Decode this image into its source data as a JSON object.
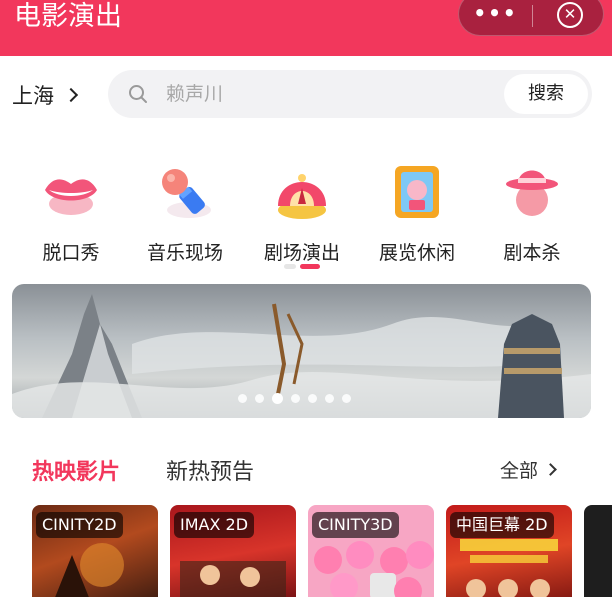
{
  "header": {
    "title": "电影演出",
    "more_label": "•••",
    "close_label": "✕"
  },
  "location": {
    "city": "上海"
  },
  "search": {
    "placeholder": "赖声川",
    "button_label": "搜索"
  },
  "categories": [
    {
      "label": "脱口秀",
      "icon": "lips-icon"
    },
    {
      "label": "音乐现场",
      "icon": "microphone-icon"
    },
    {
      "label": "剧场演出",
      "icon": "theater-curtain-icon"
    },
    {
      "label": "展览休闲",
      "icon": "picture-frame-icon"
    },
    {
      "label": "剧本杀",
      "icon": "detective-hat-icon"
    }
  ],
  "banner": {
    "slide_count": 7,
    "active_slide": 3
  },
  "movies": {
    "tabs": [
      "热映影片",
      "新热预告"
    ],
    "active_tab": 0,
    "all_label": "全部",
    "posters": [
      {
        "format": "CINITY2D"
      },
      {
        "format": "IMAX 2D"
      },
      {
        "format": "CINITY3D"
      },
      {
        "format": "中国巨幕 2D"
      }
    ]
  },
  "colors": {
    "brand": "#f2375c",
    "search_bg": "#f2f2f4"
  }
}
